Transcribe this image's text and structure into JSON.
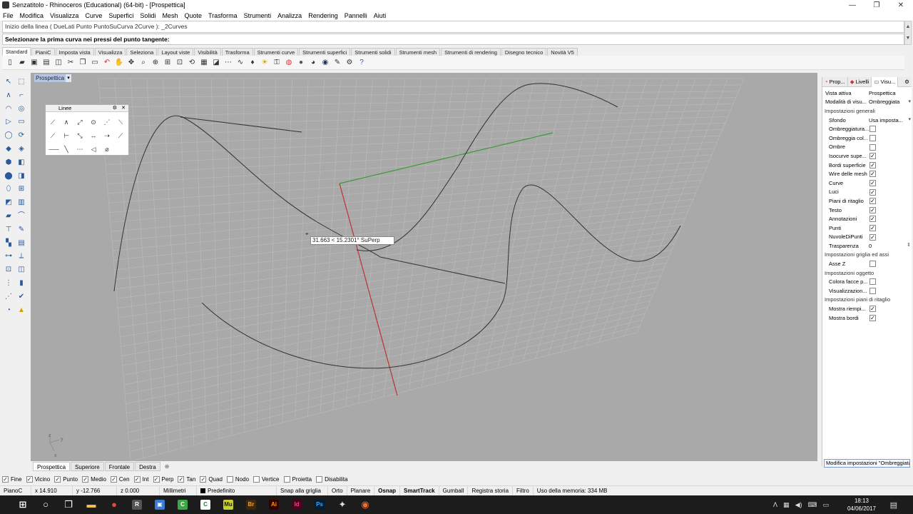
{
  "window": {
    "title": "Senzatitolo - Rhinoceros (Educational) (64-bit) - [Prospettica]",
    "controls": [
      "—",
      "❐",
      "✕"
    ]
  },
  "menu": [
    "File",
    "Modifica",
    "Visualizza",
    "Curve",
    "Superfici",
    "Solidi",
    "Mesh",
    "Quote",
    "Trasforma",
    "Strumenti",
    "Analizza",
    "Rendering",
    "Pannelli",
    "Aiuti"
  ],
  "command": {
    "history": "Inizio della linea ( DueLati  Punto  PuntoSuCurva  2Curve ):  _2Curves",
    "prompt": "Selezionare la prima curva nei pressi del punto tangente:"
  },
  "toolbar_tabs": [
    "Standard",
    "PianiC",
    "Imposta vista",
    "Visualizza",
    "Seleziona",
    "Layout viste",
    "Visibilità",
    "Trasforma",
    "Strumenti curve",
    "Strumenti superfici",
    "Strumenti solidi",
    "Strumenti mesh",
    "Strumenti di rendering",
    "Disegno tecnico",
    "Novità V5"
  ],
  "toolbar_icons": [
    "new-icon",
    "open-icon",
    "save-icon",
    "print-icon",
    "import-icon",
    "cut-icon",
    "copy-icon",
    "paste-icon",
    "undo-icon",
    "pan-icon",
    "move-view-icon",
    "zoom-icon",
    "zoom-window-icon",
    "zoom-extents-icon",
    "zoom-selected-icon",
    "rotate-view-icon",
    "grid-icon",
    "cplane-icon",
    "points-icon",
    "curves-icon",
    "lock-icon",
    "light-icon",
    "lock2-icon",
    "color-icon",
    "shade-icon",
    "render-icon",
    "material-icon",
    "options-icon",
    "properties-icon",
    "help-icon"
  ],
  "viewport": {
    "label": "Prospettica",
    "readout": "31.663 < 15.2301° SuPerp",
    "axis_y": "y",
    "axis_x": "x",
    "axis_z": "z"
  },
  "linee_panel": {
    "title": "Linee"
  },
  "view_tabs": [
    "Prospettica",
    "Superiore",
    "Frontale",
    "Destra"
  ],
  "osnaps": [
    {
      "label": "Fine",
      "checked": true
    },
    {
      "label": "Vicino",
      "checked": true
    },
    {
      "label": "Punto",
      "checked": true
    },
    {
      "label": "Medio",
      "checked": true
    },
    {
      "label": "Cen",
      "checked": true
    },
    {
      "label": "Int",
      "checked": true
    },
    {
      "label": "Perp",
      "checked": true
    },
    {
      "label": "Tan",
      "checked": true
    },
    {
      "label": "Quad",
      "checked": true
    },
    {
      "label": "Nodo",
      "checked": false
    },
    {
      "label": "Vertice",
      "checked": false
    },
    {
      "label": "Proietta",
      "checked": false
    },
    {
      "label": "Disabilita",
      "checked": false
    }
  ],
  "status": {
    "cplane": "PianoC",
    "x": "x 14.910",
    "y": "y -12.766",
    "z": "z 0.000",
    "units": "Millimetri",
    "layer": "Predefinito",
    "grid_snap": "Snap alla griglia",
    "orto": "Orto",
    "planar": "Planare",
    "osnap": "Osnap",
    "smarttrack": "SmartTrack",
    "gumball": "Gumball",
    "history": "Registra storia",
    "filter": "Filtro",
    "memory": "Uso della memoria: 334 MB"
  },
  "right_panel": {
    "tabs": [
      "Prop...",
      "Livelli",
      "Visu..."
    ],
    "rows": [
      {
        "k": "Vista attiva",
        "v": "Prospettica",
        "type": "text"
      },
      {
        "k": "Modalità di visu...",
        "v": "Ombreggiata",
        "type": "dropdown"
      },
      {
        "k": "Impostazioni generali",
        "type": "header"
      },
      {
        "k": "Sfondo",
        "v": "Usa imposta...",
        "type": "dropdown",
        "ind": true
      },
      {
        "k": "Ombreggiatura...",
        "checked": false,
        "type": "check"
      },
      {
        "k": "Ombreggia col...",
        "checked": false,
        "type": "check"
      },
      {
        "k": "Ombre",
        "checked": false,
        "type": "check"
      },
      {
        "k": "Isocurve supe...",
        "checked": true,
        "type": "check"
      },
      {
        "k": "Bordi superficie",
        "checked": true,
        "type": "check"
      },
      {
        "k": "Wire delle mesh",
        "checked": true,
        "type": "check"
      },
      {
        "k": "Curve",
        "checked": true,
        "type": "check"
      },
      {
        "k": "Luci",
        "checked": true,
        "type": "check"
      },
      {
        "k": "Piani di ritaglio",
        "checked": true,
        "type": "check"
      },
      {
        "k": "Testo",
        "checked": true,
        "type": "check"
      },
      {
        "k": "Annotazioni",
        "checked": true,
        "type": "check"
      },
      {
        "k": "Punti",
        "checked": true,
        "type": "check"
      },
      {
        "k": "NuvoleDiPunti",
        "checked": true,
        "type": "check"
      },
      {
        "k": "Trasparenza",
        "v": "0",
        "type": "spinner"
      },
      {
        "k": "Impostazioni griglia ed assi",
        "type": "header"
      },
      {
        "k": "Asse Z",
        "checked": false,
        "type": "check"
      },
      {
        "k": "Impostazioni oggetto",
        "type": "header"
      },
      {
        "k": "Colora facce p...",
        "checked": false,
        "type": "check"
      },
      {
        "k": "Visualizzazion...",
        "checked": false,
        "type": "check"
      },
      {
        "k": "Impostazioni piani di ritaglio",
        "type": "header"
      },
      {
        "k": "Mostra riempi...",
        "checked": true,
        "type": "check"
      },
      {
        "k": "Mostra bordi",
        "checked": true,
        "type": "check"
      }
    ],
    "modify_button": "Modifica impostazioni \"Ombreggiata\"..."
  },
  "taskbar": {
    "time": "18:13",
    "date": "04/06/2017",
    "apps": [
      {
        "name": "start-icon",
        "glyph": "⊞",
        "color": "#ffffff",
        "bg": "transparent"
      },
      {
        "name": "cortana-icon",
        "glyph": "○",
        "color": "#ffffff",
        "bg": "transparent"
      },
      {
        "name": "task-view-icon",
        "glyph": "❐",
        "color": "#ffffff",
        "bg": "transparent"
      },
      {
        "name": "explorer-icon",
        "glyph": "▬",
        "color": "#f2c14e",
        "bg": "transparent"
      },
      {
        "name": "chrome-icon",
        "glyph": "●",
        "color": "#e8453c",
        "bg": "transparent"
      },
      {
        "name": "rhino-icon",
        "glyph": "R",
        "color": "#ffffff",
        "bg": "#555555"
      },
      {
        "name": "store-icon",
        "glyph": "▣",
        "color": "#ffffff",
        "bg": "#3a7bd5"
      },
      {
        "name": "camtasia-icon",
        "glyph": "C",
        "color": "#ffffff",
        "bg": "#3aa845"
      },
      {
        "name": "camtasia2-icon",
        "glyph": "C",
        "color": "#2a7a3a",
        "bg": "#ffffff"
      },
      {
        "name": "muse-icon",
        "glyph": "Mu",
        "color": "#1b1b1b",
        "bg": "#c9d12e"
      },
      {
        "name": "bridge-icon",
        "glyph": "Br",
        "color": "#f0a030",
        "bg": "#3b2a10"
      },
      {
        "name": "illustrator-icon",
        "glyph": "Ai",
        "color": "#ff9a00",
        "bg": "#330000"
      },
      {
        "name": "indesign-icon",
        "glyph": "Id",
        "color": "#ff3d8b",
        "bg": "#49021f"
      },
      {
        "name": "photoshop-icon",
        "glyph": "Ps",
        "color": "#31a8ff",
        "bg": "#001e36"
      },
      {
        "name": "bird-icon",
        "glyph": "✦",
        "color": "#dddddd",
        "bg": "transparent"
      },
      {
        "name": "origin-icon",
        "glyph": "◉",
        "color": "#f56c2d",
        "bg": "transparent"
      }
    ]
  }
}
